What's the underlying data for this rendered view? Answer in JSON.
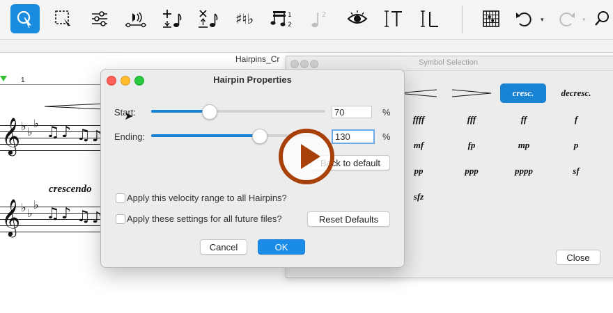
{
  "document": {
    "title": "Hairpins_Cr"
  },
  "score": {
    "ruler_number": "1",
    "annotation": "crescendo"
  },
  "palette": {
    "title": "Symbol Selection",
    "symbols": [
      {
        "label": "",
        "icon": "crescendo-hairpin"
      },
      {
        "label": "",
        "icon": "decrescendo-hairpin"
      },
      {
        "label": "cresc.",
        "selected": true
      },
      {
        "label": "decresc."
      },
      {
        "label": "ffff"
      },
      {
        "label": "fff"
      },
      {
        "label": "ff"
      },
      {
        "label": "f"
      },
      {
        "label": "mf"
      },
      {
        "label": "fp"
      },
      {
        "label": "mp"
      },
      {
        "label": "p"
      },
      {
        "label": "pp"
      },
      {
        "label": "ppp"
      },
      {
        "label": "pppp"
      },
      {
        "label": "sf"
      },
      {
        "label": "sfz"
      }
    ],
    "close_label": "Close"
  },
  "dialog": {
    "title": "Hairpin Properties",
    "start": {
      "label": "Start:",
      "value": "70",
      "unit": "%",
      "fraction": 0.33
    },
    "ending": {
      "label": "Ending:",
      "value": "130",
      "unit": "%",
      "fraction": 0.62
    },
    "back_to_default_label": "Back to default",
    "apply_all_hairpins_label": "Apply this velocity range to all Hairpins?",
    "apply_future_files_label": "Apply these settings for all future files?",
    "reset_defaults_label": "Reset Defaults",
    "cancel_label": "Cancel",
    "ok_label": "OK"
  },
  "toolbar": {
    "tools": [
      {
        "name": "select-tool",
        "glyph": "⬚"
      },
      {
        "name": "marquee-tool",
        "glyph": "⬚"
      },
      {
        "name": "mixer-tool",
        "glyph": "☰"
      },
      {
        "name": "speaker-note-tool",
        "glyph": "♪"
      },
      {
        "name": "add-note-tool",
        "glyph": "♪"
      },
      {
        "name": "remove-note-tool",
        "glyph": "♪"
      },
      {
        "name": "accidentals-tool",
        "glyph": "♯♭"
      },
      {
        "name": "tuplet-tool",
        "glyph": "♫"
      },
      {
        "name": "voice-2-tool",
        "glyph": "♩"
      },
      {
        "name": "view-tool",
        "glyph": "◉"
      },
      {
        "name": "text-tool",
        "glyph": "IT"
      },
      {
        "name": "lyrics-tool",
        "glyph": "IL"
      },
      {
        "name": "chord-diagram-tool",
        "glyph": "▦"
      },
      {
        "name": "undo-tool",
        "glyph": "↶"
      },
      {
        "name": "redo-tool",
        "glyph": "↷"
      },
      {
        "name": "search-tool",
        "glyph": "⌕"
      }
    ]
  },
  "colors": {
    "accent": "#1a84d4",
    "play": "#a8400a"
  }
}
